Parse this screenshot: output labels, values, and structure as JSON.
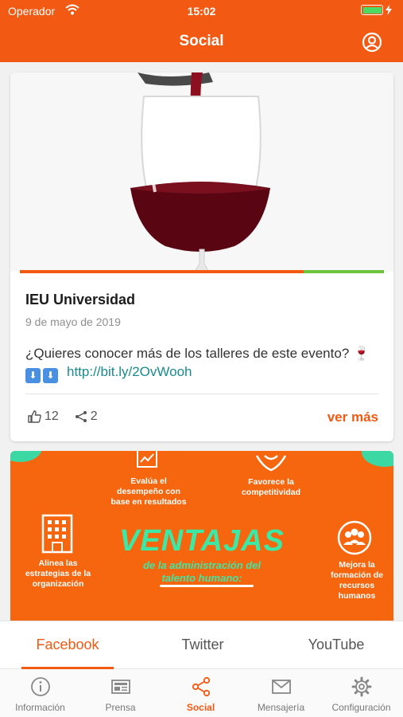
{
  "status_bar": {
    "carrier": "Operador",
    "time": "15:02"
  },
  "header": {
    "title": "Social"
  },
  "post": {
    "author": "IEU Universidad",
    "date": "9 de mayo de 2019",
    "text": "¿Quieres conocer más de los talleres de este evento? 🍷",
    "arrow_emoji": "⬇",
    "link": "http://bit.ly/2OvWooh",
    "likes": "12",
    "shares": "2",
    "more_label": "ver más",
    "media_progress": 0.78
  },
  "infographic": {
    "item1": "Evalúa el desempeño con base en resultados",
    "item2": "Favorece la competitividad",
    "item3": "Alinea las estrategias de la organización",
    "item4": "Mejora la formación de recursos humanos",
    "headline": "VENTAJAS",
    "subline1": "de la administración del",
    "subline2": "talento humano:"
  },
  "source_tabs": [
    "Facebook",
    "Twitter",
    "YouTube"
  ],
  "bottom_nav": [
    "Información",
    "Prensa",
    "Social",
    "Mensajería",
    "Configuración"
  ],
  "colors": {
    "accent": "#f25a13",
    "link": "#1a8a8e",
    "infographic_bg": "#f5660f",
    "infographic_accent": "#3de8a4"
  }
}
